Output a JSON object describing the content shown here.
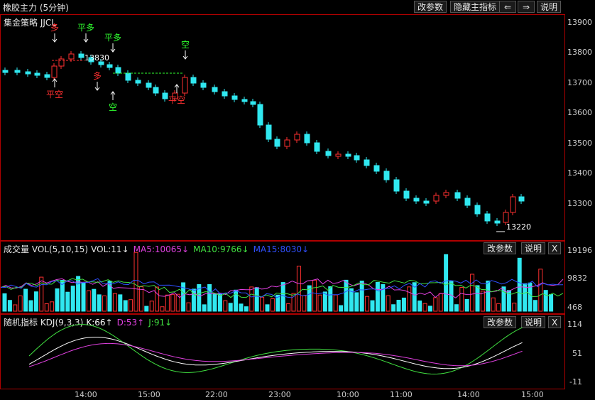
{
  "window": {
    "title": "橡胶主力 (5分钟)",
    "buttons": {
      "params": "改参数",
      "hide_indicator": "隐藏主指标",
      "prev": "⇐",
      "next": "⇒",
      "help": "说明"
    }
  },
  "price_panel": {
    "strategy": "集金策略 JJCL",
    "y_ticks": [
      "13900",
      "13800",
      "13700",
      "13600",
      "13500",
      "13400",
      "13300"
    ],
    "high_label": "13830",
    "low_label": "13220",
    "signals": [
      {
        "text": "多",
        "color": "#ff3030"
      },
      {
        "text": "平空",
        "color": "#ff3030"
      },
      {
        "text": "平多",
        "color": "#30ff30"
      },
      {
        "text": "平多",
        "color": "#30ff30"
      },
      {
        "text": "多",
        "color": "#ff3030"
      },
      {
        "text": "空",
        "color": "#30ff30"
      },
      {
        "text": "平空",
        "color": "#ff3030"
      },
      {
        "text": "空",
        "color": "#30ff30"
      }
    ]
  },
  "volume_panel": {
    "label": "成交量 VOL(5,10,15)",
    "vol": "VOL:11↓",
    "ma5": "MA5:10065↓",
    "ma10": "MA10:9766↓",
    "ma15": "MA15:8030↓",
    "colors": {
      "ma5": "#e040e0",
      "ma10": "#40e040",
      "ma15": "#3050ff"
    },
    "y_ticks": [
      "19196",
      "9832",
      "468"
    ],
    "buttons": {
      "params": "改参数",
      "help": "说明",
      "close": "X"
    }
  },
  "kdj_panel": {
    "label": "随机指标 KDJ(9,3,3)",
    "k": "K:66↑",
    "d": "D:53↑",
    "j": "J:91↓",
    "colors": {
      "k": "#ffffff",
      "d": "#e040e0",
      "j": "#40e040"
    },
    "y_ticks": [
      "114",
      "51",
      "-11"
    ],
    "buttons": {
      "params": "改参数",
      "help": "说明",
      "close": "X"
    }
  },
  "time_axis": [
    "14:00",
    "15:00",
    "22:00",
    "23:00",
    "10:00",
    "11:00",
    "14:00",
    "15:00"
  ]
}
